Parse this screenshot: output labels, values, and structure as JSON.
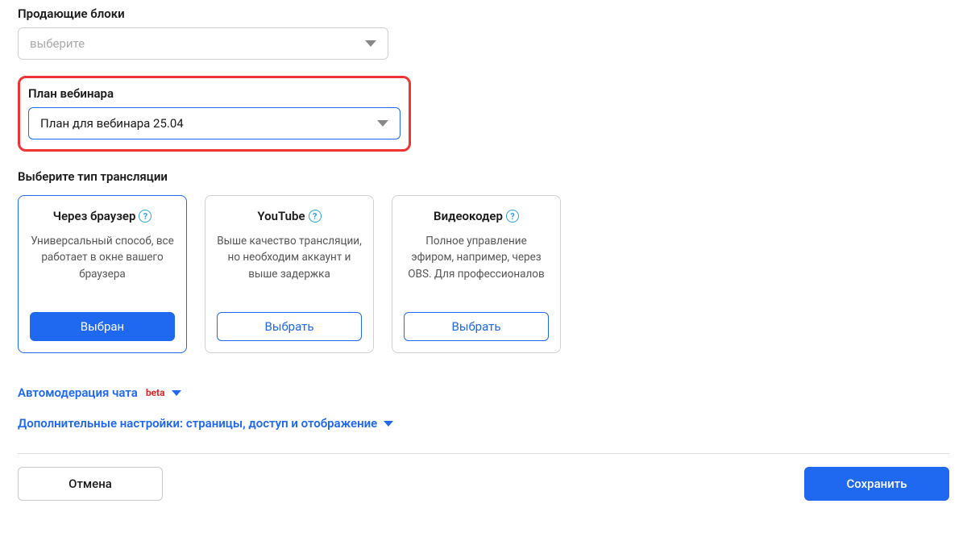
{
  "sellingBlocks": {
    "label": "Продающие блоки",
    "placeholder": "выберите"
  },
  "webinarPlan": {
    "label": "План вебинара",
    "selected": "План для вебинара 25.04"
  },
  "streamType": {
    "title": "Выберите тип трансляции",
    "cards": [
      {
        "title": "Через браузер",
        "desc": "Универсальный способ, все работает в окне вашего браузера",
        "button": "Выбран"
      },
      {
        "title": "YouTube",
        "desc": "Выше качество трансляции, но необходим аккаунт и выше задержка",
        "button": "Выбрать"
      },
      {
        "title": "Видеокодер",
        "desc": "Полное управление эфиром, например, через OBS. Для профессионалов",
        "button": "Выбрать"
      }
    ]
  },
  "expandLinks": {
    "automoderation": "Автомодерация чата",
    "automoderationBadge": "beta",
    "additional": "Дополнительные настройки: страницы, доступ и отображение"
  },
  "footer": {
    "cancel": "Отмена",
    "save": "Сохранить"
  }
}
